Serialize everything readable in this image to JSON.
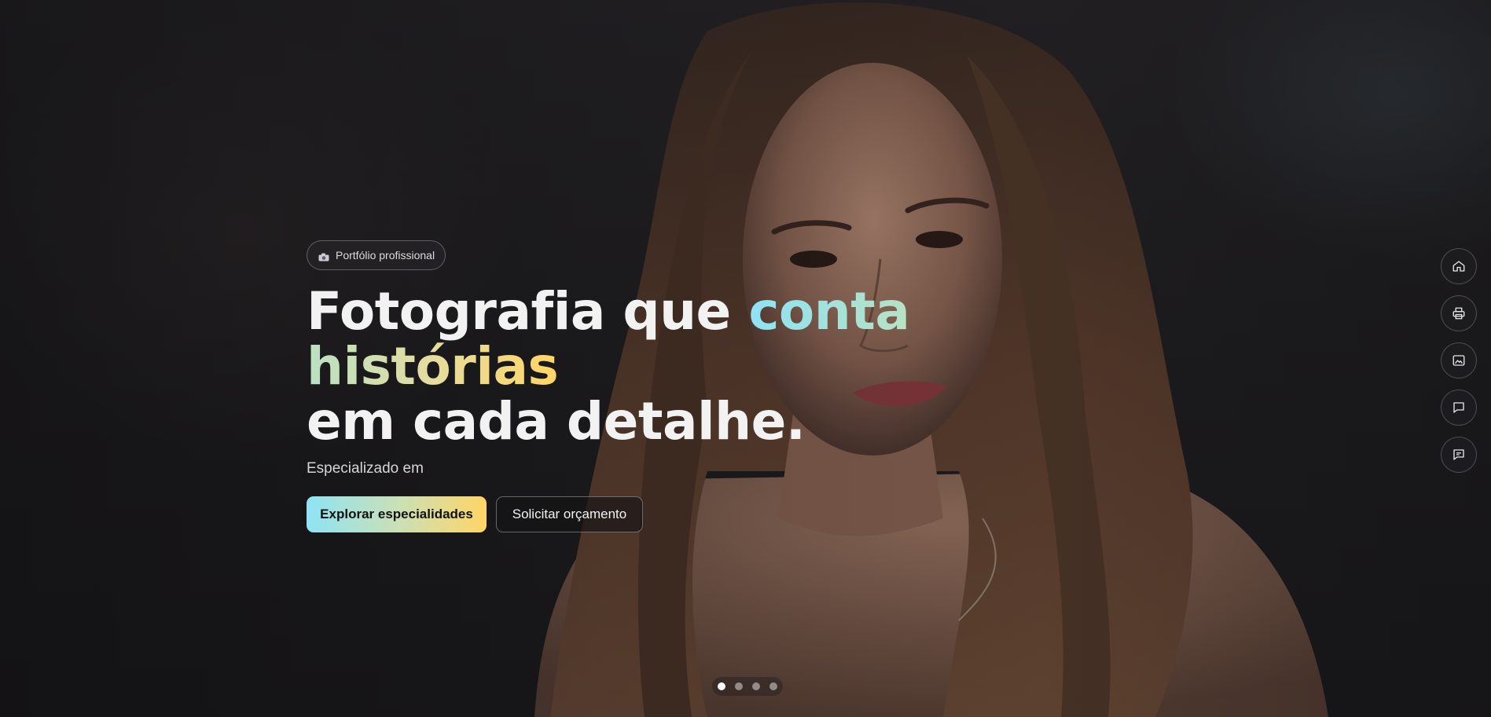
{
  "hero": {
    "badge": {
      "icon": "camera-icon",
      "label": "Portfólio profissional"
    },
    "headline": {
      "line1_plain": "Fotografia que ",
      "line1_highlight": "conta histórias",
      "line2": "em cada detalhe."
    },
    "subtitle": "Especializado em",
    "primary_button": "Explorar especialidades",
    "secondary_button": "Solicitar orçamento",
    "gradient_colors": [
      "#8ee3f5",
      "#ffd565"
    ]
  },
  "side_nav": [
    {
      "icon": "home-icon"
    },
    {
      "icon": "printer-icon"
    },
    {
      "icon": "image-icon"
    },
    {
      "icon": "chat-bubble-icon"
    },
    {
      "icon": "message-square-icon"
    }
  ],
  "carousel": {
    "slide_count": 4,
    "active_index": 0
  }
}
